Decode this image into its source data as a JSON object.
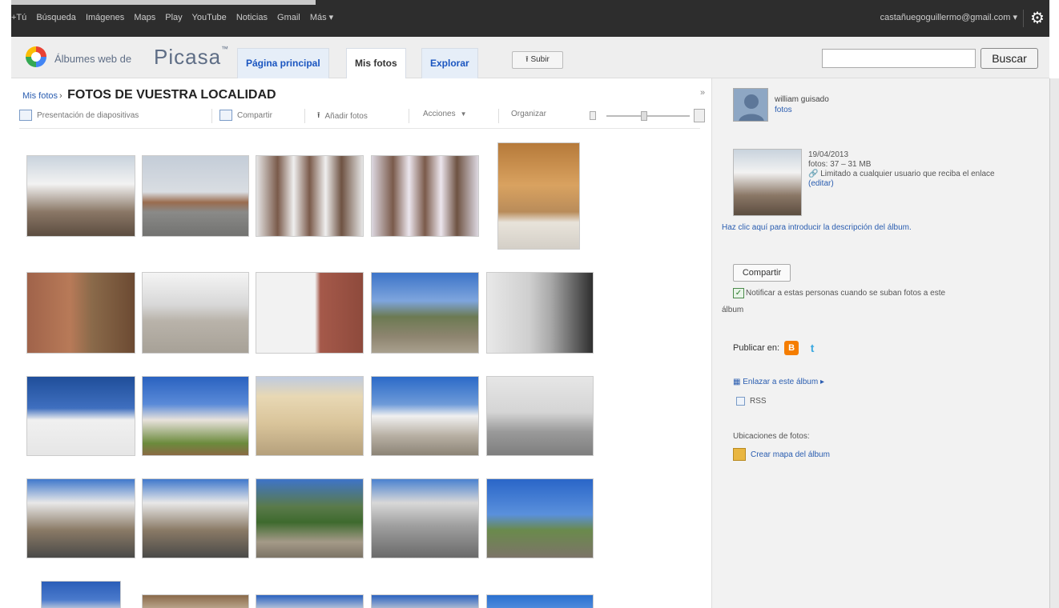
{
  "gbar": {
    "nav": [
      "+Tú",
      "Búsqueda",
      "Imágenes",
      "Maps",
      "Play",
      "YouTube",
      "Noticias",
      "Gmail",
      "Más ▾"
    ],
    "account": "castañuegoguillermo@gmail.com ▾",
    "settings_icon": "gear-icon"
  },
  "header": {
    "logo_text": "Álbumes web de",
    "logo_brand": "Picasa",
    "tabs": [
      {
        "label": "Página principal",
        "active": false
      },
      {
        "label": "Mis fotos",
        "active": true
      },
      {
        "label": "Explorar",
        "active": false
      }
    ],
    "upload_label": "Subir",
    "search_value": "",
    "search_button": "Buscar"
  },
  "main": {
    "breadcrumb_link": "Mis fotos",
    "breadcrumb_sep": "›",
    "album_title": "FOTOS DE VUESTRA LOCALIDAD",
    "toolbar": {
      "slideshow": "Presentación de diapositivas",
      "share": "Compartir",
      "add_photos": "Añadir fotos",
      "actions": "Acciones",
      "organize": "Organizar"
    }
  },
  "sidebar": {
    "owner_name": "william guisado",
    "owner_link": "fotos",
    "album_date": "19/04/2013",
    "album_stats": "fotos: 37 – 31 MB",
    "sharing": "Limitado a cualquier usuario que reciba el enlace",
    "edit_link": "(editar)",
    "desc_link": "Haz clic aquí para introducir la descripción del álbum.",
    "share_button": "Compartir",
    "notify_text": "Notificar a estas personas cuando se suban fotos a este",
    "notify_text_cont": "álbum",
    "publish_label": "Publicar en:",
    "embed_link": "Enlazar a este álbum ▸",
    "rss_label": "RSS",
    "locations_label": "Ubicaciones de fotos:",
    "map_link": "Crear mapa del álbum"
  },
  "colors": {
    "gbar_bg": "#2d2d2d",
    "header_bg": "#eeeeee",
    "link": "#2a5db0",
    "sidebar_bg": "#f2f2f2"
  }
}
